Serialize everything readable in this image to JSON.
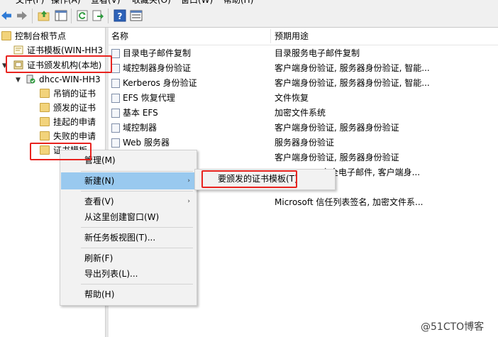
{
  "menubar": {
    "items": [
      {
        "label": "文件(F)"
      },
      {
        "label": "操作(A)"
      },
      {
        "label": "查看(V)"
      },
      {
        "label": "收藏夹(O)"
      },
      {
        "label": "窗口(W)"
      },
      {
        "label": "帮助(H)"
      }
    ]
  },
  "toolbar": {
    "icons": [
      "back-arrow-icon",
      "forward-arrow-icon",
      "up-folder-icon",
      "show-tree-icon",
      "refresh-icon",
      "export-list-icon",
      "help-icon",
      "properties-icon"
    ]
  },
  "tree": {
    "root": "控制台根节点",
    "templates_snapin": "证书模板(WIN-HH3",
    "ca_local": "证书颁发机构(本地)",
    "server": "dhcc-WIN-HH3",
    "revoked": "吊销的证书",
    "issued": "颁发的证书",
    "pending": "挂起的申请",
    "failed": "失败的申请",
    "cert_templates": "证书模板"
  },
  "list": {
    "col_name": "名称",
    "col_purpose": "预期用途",
    "rows": [
      {
        "name": "目录电子邮件复制",
        "purpose": "目录服务电子邮件复制"
      },
      {
        "name": "域控制器身份验证",
        "purpose": "客户端身份验证, 服务器身份验证, 智能..."
      },
      {
        "name": "Kerberos 身份验证",
        "purpose": "客户端身份验证, 服务器身份验证, 智能..."
      },
      {
        "name": "EFS 恢复代理",
        "purpose": "文件恢复"
      },
      {
        "name": "基本 EFS",
        "purpose": "加密文件系统"
      },
      {
        "name": "域控制器",
        "purpose": "客户端身份验证, 服务器身份验证"
      },
      {
        "name": "Web 服务器",
        "purpose": "服务器身份验证"
      },
      {
        "name": "",
        "purpose": "客户端身份验证, 服务器身份验证"
      },
      {
        "name": "",
        "purpose": "安全电子邮件, 客户端身..."
      },
      {
        "name": "",
        "purpose": ""
      },
      {
        "name": "",
        "purpose": "Microsoft 信任列表签名, 加密文件系..."
      }
    ]
  },
  "context_menu": {
    "manage": "管理(M)",
    "new": "新建(N)",
    "view": "查看(V)",
    "new_window": "从这里创建窗口(W)",
    "taskpad": "新任务板视图(T)...",
    "refresh": "刷新(F)",
    "export": "导出列表(L)...",
    "help": "帮助(H)",
    "arrow": "›"
  },
  "submenu": {
    "issue_template": "要颁发的证书模板(T)"
  },
  "watermark": "@51CTO博客",
  "colors": {
    "highlight": "#99c9ef",
    "annotation_red": "#e8231f",
    "folder": "#f2d37b"
  }
}
